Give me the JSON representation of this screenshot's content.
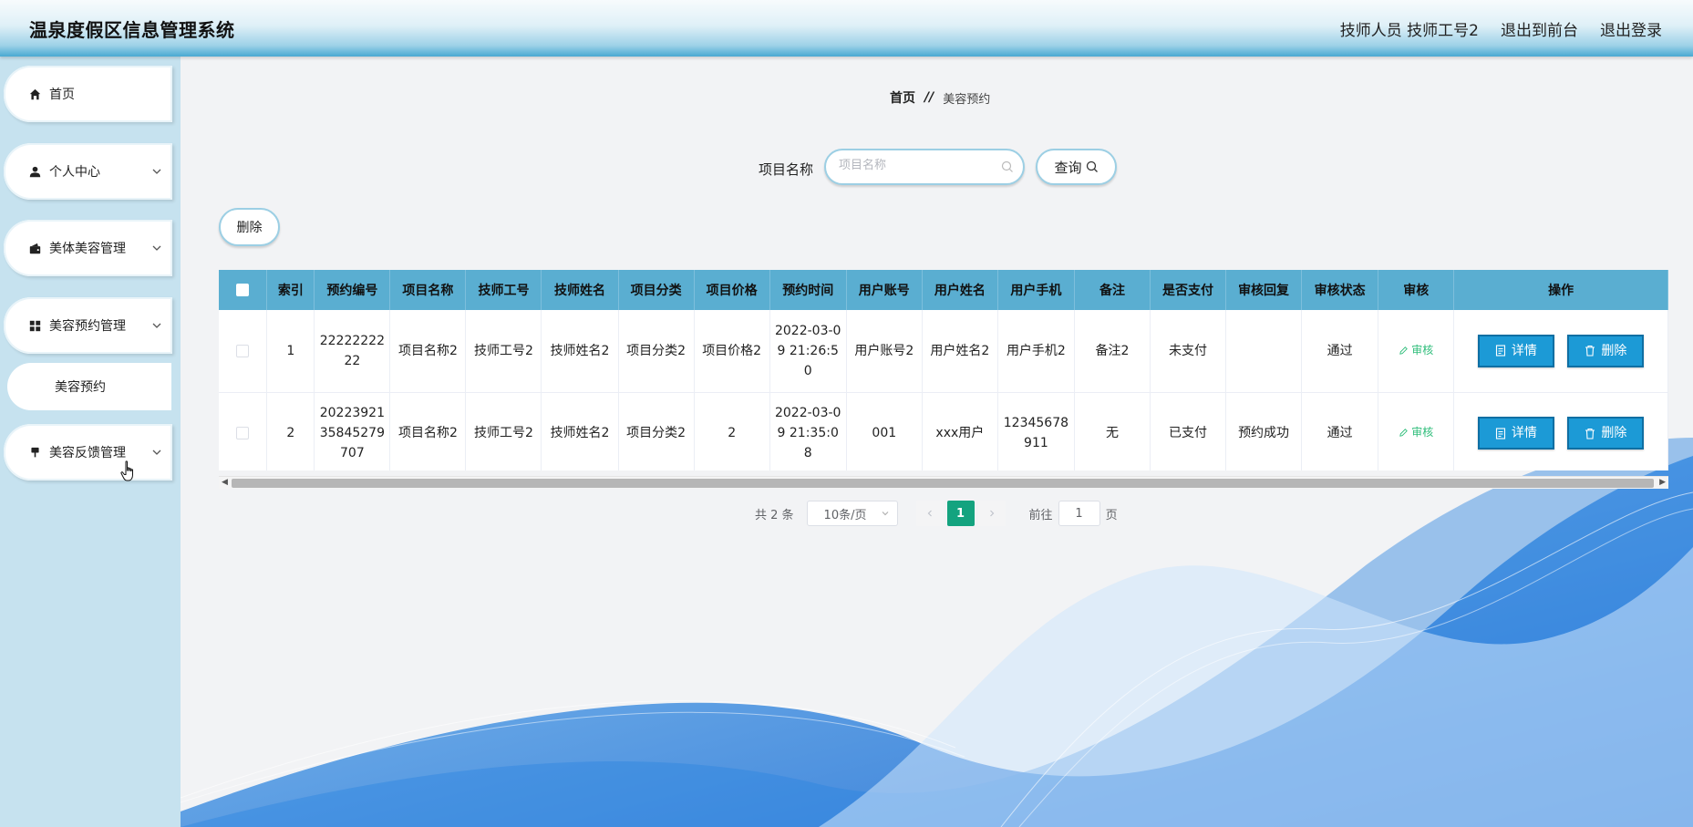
{
  "header": {
    "title": "温泉度假区信息管理系统",
    "user": "技师人员 技师工号2",
    "back_front": "退出到前台",
    "logout": "退出登录"
  },
  "sidebar": {
    "items": [
      {
        "label": "首页",
        "icon": "home-icon"
      },
      {
        "label": "个人中心",
        "icon": "user-icon"
      },
      {
        "label": "美体美容管理",
        "icon": "wallet-icon"
      },
      {
        "label": "美容预约管理",
        "icon": "grid-icon"
      },
      {
        "label": "美容预约",
        "icon": ""
      },
      {
        "label": "美容反馈管理",
        "icon": "pin-icon"
      }
    ]
  },
  "breadcrumb": {
    "home": "首页",
    "sep": "//",
    "current": "美容预约"
  },
  "search": {
    "label": "项目名称",
    "placeholder": "项目名称",
    "value": "",
    "button": "查询"
  },
  "actions": {
    "delete": "删除"
  },
  "table": {
    "headers": [
      "索引",
      "预约编号",
      "项目名称",
      "技师工号",
      "技师姓名",
      "项目分类",
      "项目价格",
      "预约时间",
      "用户账号",
      "用户姓名",
      "用户手机",
      "备注",
      "是否支付",
      "审核回复",
      "审核状态",
      "审核",
      "操作"
    ],
    "rows": [
      [
        "1",
        "2222222222",
        "项目名称2",
        "技师工号2",
        "技师姓名2",
        "项目分类2",
        "项目价格2",
        "2022-03-09 21:26:50",
        "用户账号2",
        "用户姓名2",
        "用户手机2",
        "备注2",
        "未支付",
        "",
        "通过"
      ],
      [
        "2",
        "2022392135845279707",
        "项目名称2",
        "技师工号2",
        "技师姓名2",
        "项目分类2",
        "2",
        "2022-03-09 21:35:08",
        "001",
        "xxx用户",
        "12345678911",
        "无",
        "已支付",
        "预约成功",
        "通过"
      ]
    ],
    "audit_label": "审核",
    "detail_label": "详情",
    "delete_label": "删除"
  },
  "pagination": {
    "total": "共 2 条",
    "page_size": "10条/页",
    "current_page": "1",
    "goto_prefix": "前往",
    "goto_value": "1",
    "goto_suffix": "页"
  },
  "colors": {
    "header_blue": "#49a9d2",
    "table_head": "#5aaed1",
    "primary_btn": "#1c9ad6",
    "page_active": "#14a37f",
    "audit_green": "#2ebd7a",
    "sidebar_bg": "#c6e2ef"
  }
}
